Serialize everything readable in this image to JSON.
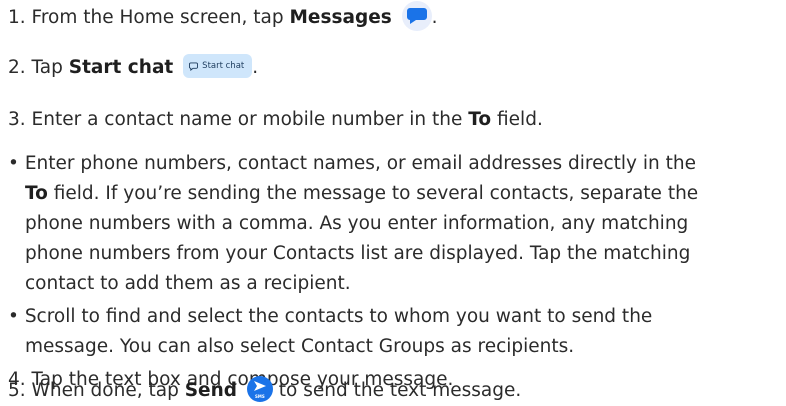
{
  "steps": [
    {
      "number": "1.",
      "pre": "From the Home screen, tap ",
      "bold": "Messages",
      "post": "."
    },
    {
      "number": "2.",
      "pre": "Tap ",
      "bold": "Start chat",
      "chip_label": "Start chat",
      "post": "."
    },
    {
      "number": "3.",
      "pre": "Enter a contact name or mobile number in the ",
      "bold": "To",
      "post": " field."
    },
    {
      "number": "4.",
      "text": "Tap the text box and compose your message."
    },
    {
      "number": "5.",
      "pre": "When done, tap ",
      "bold": "Send",
      "post": " to send the text message.",
      "icon_label": "SMS"
    }
  ],
  "bullets": [
    {
      "marker": "•",
      "line1": "Enter phone numbers, contact names, or email addresses directly in the",
      "line2_bold": "To",
      "line2_rest": " field. If you’re sending the message to several contacts, separate the",
      "line3": "phone numbers with a comma. As you enter information, any matching",
      "line4": "phone numbers from your Contacts list are displayed. Tap the matching",
      "line5": "contact to add them as a recipient."
    },
    {
      "marker": "•",
      "line1": "Scroll to find and select the contacts to whom you want to send the",
      "line2": "message. You can also select Contact Groups as recipients."
    }
  ],
  "colors": {
    "text": "#2b2b2b",
    "messages_icon_bg": "#e8eefb",
    "messages_icon_fg": "#1a73e8",
    "chip_bg": "#cfe6fb",
    "send_icon_bg": "#1a73e8"
  },
  "icons": {
    "messages": "messages-bubble-icon",
    "start_chat": "chat-bubble-icon",
    "send": "send-sms-icon"
  }
}
